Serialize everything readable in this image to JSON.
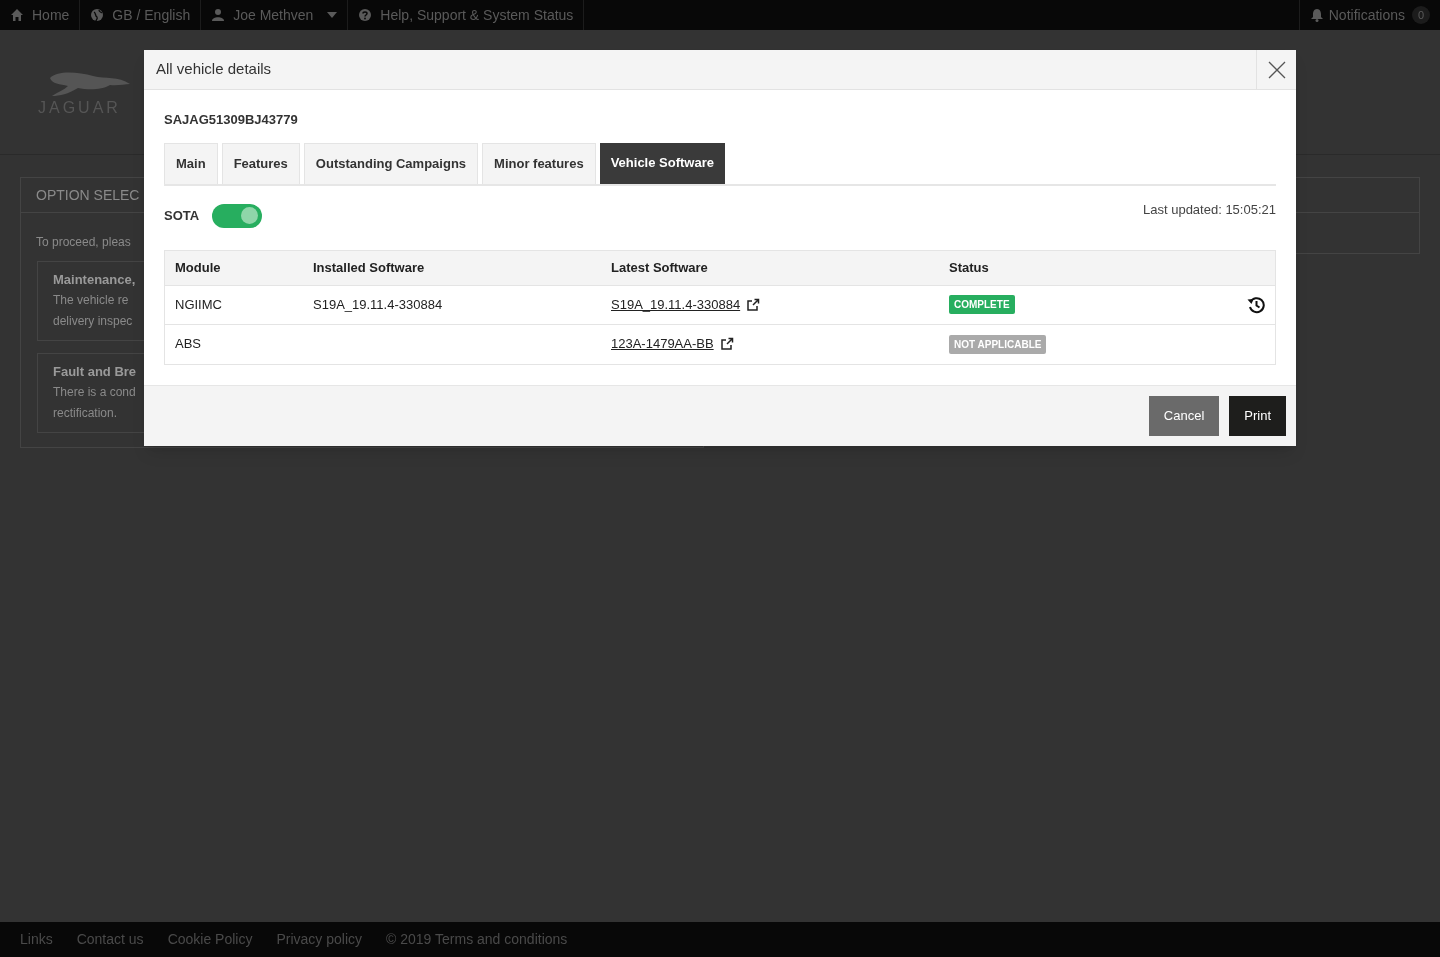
{
  "nav": {
    "items": [
      {
        "kind": "home",
        "label": "Home"
      },
      {
        "kind": "globe",
        "label": "GB / English"
      },
      {
        "kind": "user",
        "label": "Joe Methven"
      },
      {
        "kind": "help",
        "label": "Help, Support & System Status"
      }
    ],
    "notifications": {
      "label": "Notifications",
      "count": "0"
    }
  },
  "logo": {
    "text": "JAGUAR"
  },
  "background_card": {
    "title": "OPTION SELEC",
    "intro": "To proceed, pleas",
    "options": [
      {
        "title": "Maintenance,",
        "lines": [
          "The vehicle re",
          "delivery inspec"
        ]
      },
      {
        "title": "Fault and Bre",
        "lines": [
          "There is a cond",
          "rectification."
        ]
      }
    ]
  },
  "modal": {
    "title": "All vehicle details",
    "vin": "SAJAG51309BJ43779",
    "tabs": [
      {
        "label": "Main",
        "selected": false
      },
      {
        "label": "Features",
        "selected": false
      },
      {
        "label": "Outstanding Campaigns",
        "selected": false
      },
      {
        "label": "Minor features",
        "selected": false
      },
      {
        "label": "Vehicle Software",
        "selected": true
      }
    ],
    "sota": {
      "label": "SOTA",
      "on": true
    },
    "last_updated": "Last updated: 15:05:21",
    "table": {
      "columns": [
        "Module",
        "Installed Software",
        "Latest Software",
        "Status"
      ],
      "rows": [
        {
          "module": "NGIIMC",
          "installed": "S19A_19.11.4-330884",
          "latest": "S19A_19.11.4-330884",
          "status": "COMPLETE",
          "color": "#27ae5f",
          "history": true
        },
        {
          "module": "ABS",
          "latest": "123A-1479AA-BB",
          "status": "NOT APPLICABLE",
          "color": "#aaaaaa",
          "history": false
        }
      ]
    },
    "buttons": [
      {
        "label": "Cancel",
        "kind": "secondary"
      },
      {
        "label": "Print",
        "kind": "primary"
      }
    ]
  },
  "footer": {
    "links": [
      "Links",
      "Contact us",
      "Cookie Policy",
      "Privacy policy",
      "© 2019 Terms and conditions"
    ]
  }
}
